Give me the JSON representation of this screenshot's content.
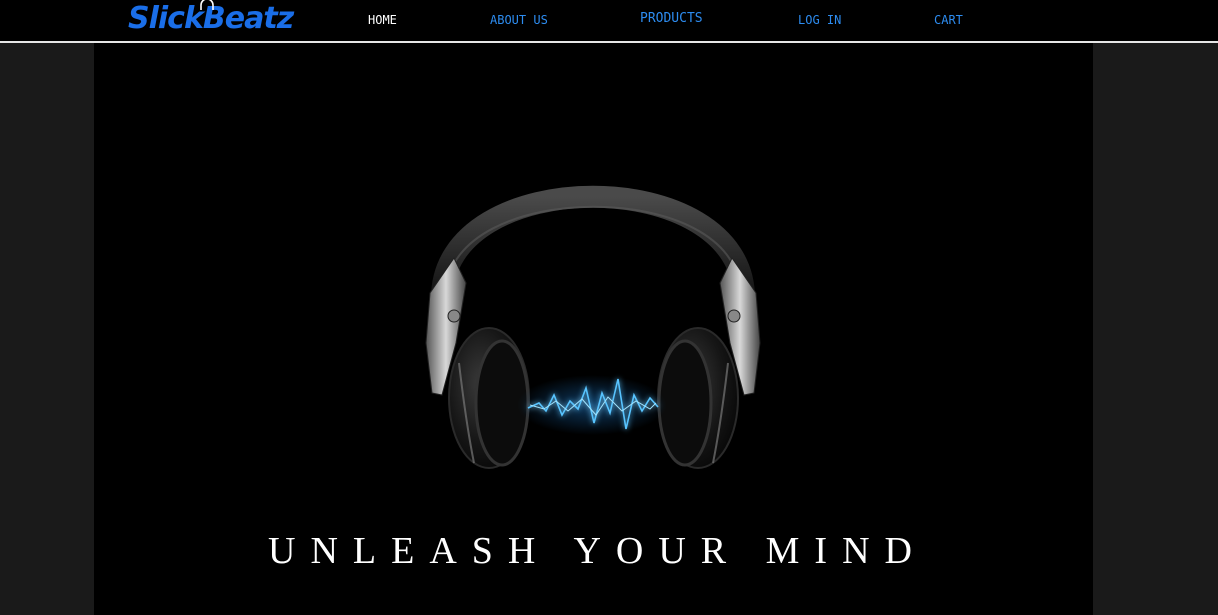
{
  "brand": {
    "name": "SlickBeatz",
    "color": "#1a6ee8"
  },
  "nav": {
    "items": [
      {
        "label": "HOME",
        "active": true
      },
      {
        "label": "ABOUT US",
        "active": false
      },
      {
        "label": "PRODUCTS",
        "active": false
      },
      {
        "label": "LOG IN",
        "active": false
      },
      {
        "label": "CART",
        "active": false
      }
    ],
    "active_color": "#ffffff",
    "link_color": "#2d8cf0"
  },
  "hero": {
    "tagline": "UNLEASH YOUR MIND",
    "image": "headphones-with-blue-soundwave"
  }
}
